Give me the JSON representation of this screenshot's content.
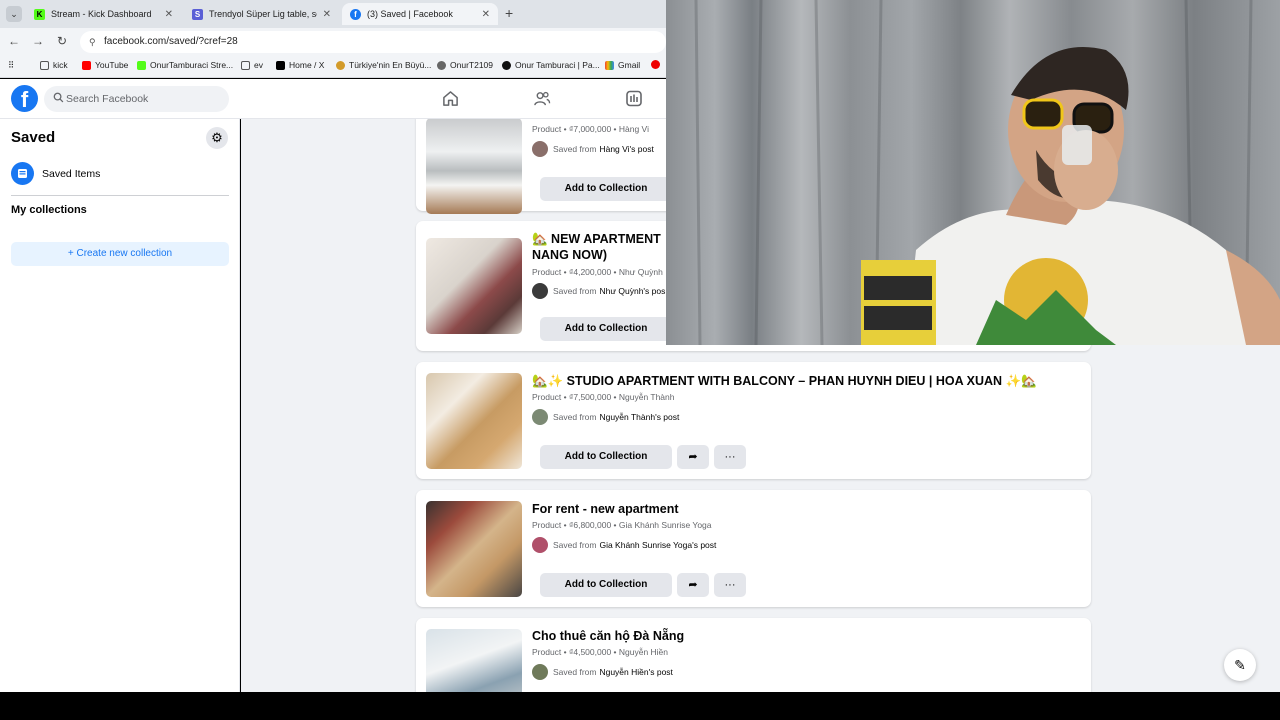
{
  "browser": {
    "tabs": [
      {
        "title": "Stream - Kick Dashboard",
        "active": false
      },
      {
        "title": "Trendyol Süper Lig table, sched",
        "active": false
      },
      {
        "title": "(3) Saved | Facebook",
        "active": true
      }
    ],
    "url": "facebook.com/saved/?cref=28",
    "bookmarks": [
      "kick",
      "YouTube",
      "OnurTamburaci Stre...",
      "ev",
      "Home / X",
      "Türkiye'nin En Büyü...",
      "OnurT2109",
      "Onur Tamburaci | Pa...",
      "Gmail"
    ]
  },
  "header": {
    "search_placeholder": "Search Facebook",
    "nav_icons": [
      "home-icon",
      "friends-icon",
      "dashboard-icon"
    ]
  },
  "sidebar": {
    "title": "Saved",
    "saved_items_label": "Saved Items",
    "my_collections_label": "My collections",
    "create_label": "+ Create new collection"
  },
  "cards": [
    {
      "title": "",
      "meta": "Product • ₫7,000,000 • Hàng Vi",
      "saved_prefix": "Saved from",
      "saved_from": "Hàng Vi's post",
      "add_label": "Add to Collection"
    },
    {
      "title": "🏡 NEW APARTMENT",
      "title2": "NANG NOW)",
      "meta": "Product • ₫4,200,000 • Như Quỳnh",
      "saved_prefix": "Saved from",
      "saved_from": "Như Quỳnh's pos",
      "add_label": "Add to Collection"
    },
    {
      "title": "🏡✨ STUDIO APARTMENT WITH BALCONY – PHAN HUYNH DIEU | HOA XUAN ✨🏡",
      "meta": "Product • ₫7,500,000 • Nguyễn Thành",
      "saved_prefix": "Saved from",
      "saved_from": "Nguyễn Thành's post",
      "add_label": "Add to Collection"
    },
    {
      "title": "For rent - new apartment",
      "meta": "Product • ₫6,800,000 • Gia Khánh Sunrise Yoga",
      "saved_prefix": "Saved from",
      "saved_from": "Gia Khánh Sunrise Yoga's post",
      "add_label": "Add to Collection"
    },
    {
      "title": "Cho thuê căn hộ Đà Nẵng",
      "meta": "Product • ₫4,500,000 • Nguyễn Hiền",
      "saved_prefix": "Saved from",
      "saved_from": "Nguyễn Hiền's post",
      "add_label": "Add to Collection"
    }
  ],
  "more_label": "···"
}
